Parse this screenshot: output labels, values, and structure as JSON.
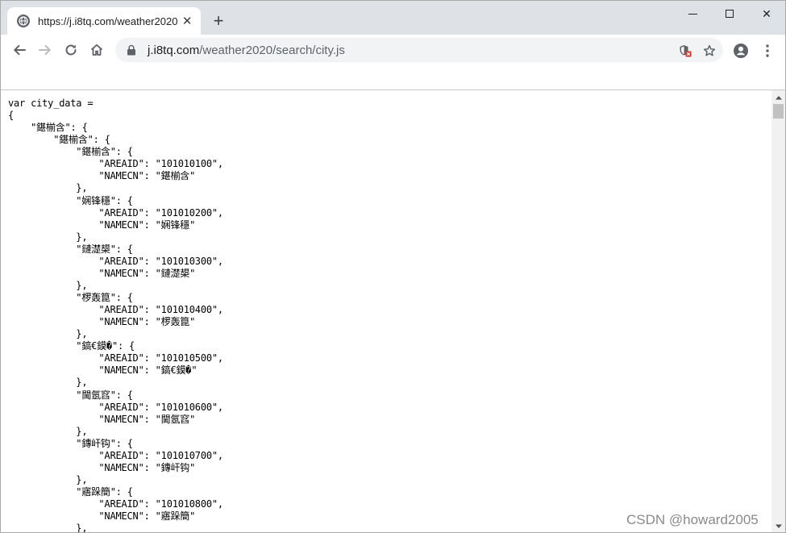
{
  "tab": {
    "title": "https://j.i8tq.com/weather2020",
    "close_label": "✕",
    "favicon": "globe-icon"
  },
  "new_tab_label": "+",
  "window_controls": {
    "close_label": "✕"
  },
  "address": {
    "host": "j.i8tq.com",
    "path": "/weather2020/search/city.js"
  },
  "page": {
    "code_lines": [
      "var city_data =",
      "{",
      "    \"鍖椾含\": {",
      "        \"鍖椾含\": {",
      "            \"鍖椾含\": {",
      "                \"AREAID\": \"101010100\",",
      "                \"NAMECN\": \"鍖椾含\"",
      "            },",
      "            \"娴锋穩\": {",
      "                \"AREAID\": \"101010200\",",
      "                \"NAMECN\": \"娴锋穩\"",
      "            },",
      "            \"鏈濋槼\": {",
      "                \"AREAID\": \"101010300\",",
      "                \"NAMECN\": \"鏈濋槼\"",
      "            },",
      "            \"椤轰箟\": {",
      "                \"AREAID\": \"101010400\",",
      "                \"NAMECN\": \"椤轰箟\"",
      "            },",
      "            \"鎬€鏌�\": {",
      "                \"AREAID\": \"101010500\",",
      "                \"NAMECN\": \"鎬€鏌�\"",
      "            },",
      "            \"閫氬窞\": {",
      "                \"AREAID\": \"101010600\",",
      "                \"NAMECN\": \"閫氬窞\"",
      "            },",
      "            \"鏄屽钩\": {",
      "                \"AREAID\": \"101010700\",",
      "                \"NAMECN\": \"鏄屽钩\"",
      "            },",
      "            \"寤跺簡\": {",
      "                \"AREAID\": \"101010800\",",
      "                \"NAMECN\": \"寤跺簡\"",
      "            },"
    ]
  },
  "watermark": "CSDN @howard2005",
  "colors": {
    "tabstrip": "#dee1e6",
    "omnibox": "#f1f3f4",
    "icon": "#5f6368"
  }
}
